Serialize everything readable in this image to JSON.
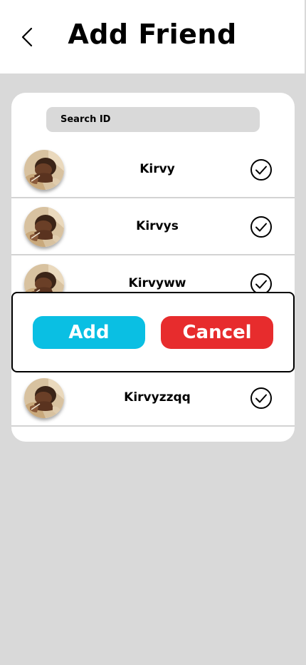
{
  "header": {
    "title": "Add Friend",
    "back_icon": "chevron-left-icon"
  },
  "search": {
    "placeholder": "Search ID"
  },
  "friends": [
    {
      "name": "Kirvy",
      "status_icon": "check-circle-icon"
    },
    {
      "name": "Kirvys",
      "status_icon": "check-circle-icon"
    },
    {
      "name": "Kirvyww",
      "status_icon": "check-circle-icon"
    },
    {
      "name": "",
      "status_icon": "check-circle-icon"
    },
    {
      "name": "Kirvyzzqq",
      "status_icon": "check-circle-icon"
    }
  ],
  "dialog": {
    "add_label": "Add",
    "cancel_label": "Cancel"
  },
  "colors": {
    "background": "#d9d9d9",
    "add_button": "#0abfe3",
    "cancel_button": "#e72c2d",
    "divider": "#d3d3d3"
  }
}
